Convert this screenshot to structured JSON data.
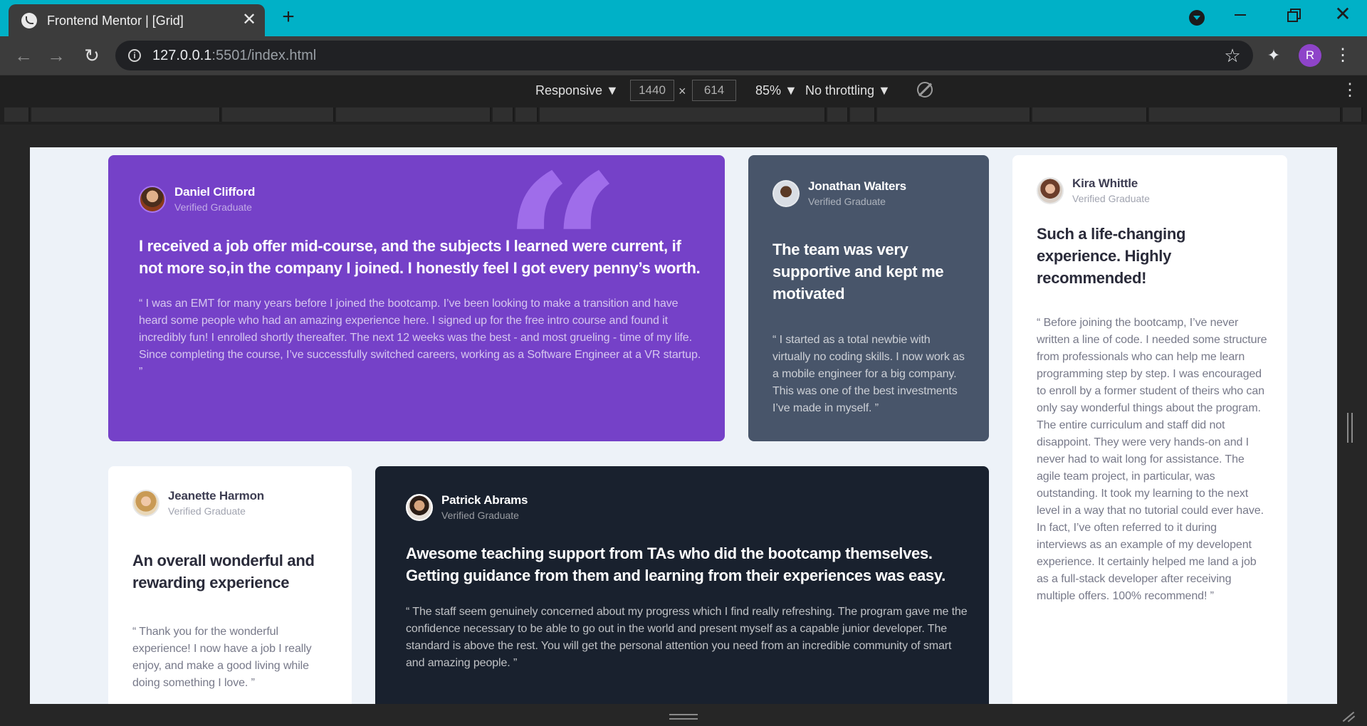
{
  "browser": {
    "tab_title": "Frontend Mentor | [Grid]",
    "url_host": "127.0.0.1",
    "url_rest": ":5501/index.html",
    "profile_initial": "R"
  },
  "devtools": {
    "device": "Responsive ▼",
    "width": "1440",
    "height": "614",
    "times": "×",
    "zoom": "85% ▼",
    "throttling": "No throttling ▼"
  },
  "cards": {
    "daniel": {
      "name": "Daniel Clifford",
      "role": "Verified Graduate",
      "headline": "I received a job offer mid-course, and the subjects I learned were current, if not more so,in the company I joined. I honestly feel I got every penny’s worth.",
      "body": "“ I was an EMT for many years before I joined the bootcamp. I’ve been looking to make a transition and have heard some people who had an amazing experience here. I signed up for the free intro course and found it incredibly fun! I enrolled shortly thereafter. The next 12 weeks was the best - and most grueling - time of my life. Since completing the course, I’ve successfully switched careers, working as a Software Engineer at a VR startup. ”",
      "quote_glyph": "“"
    },
    "jonathan": {
      "name": "Jonathan Walters",
      "role": "Verified Graduate",
      "headline": "The team was very supportive and kept me motivated",
      "body": "“ I started as a total newbie with virtually no coding skills. I now work as a mobile engineer for a big company. This was one of the best investments I’ve made in myself. ”"
    },
    "kira": {
      "name": "Kira Whittle",
      "role": "Verified Graduate",
      "headline": "Such a life-changing experience. Highly recommended!",
      "body": "“ Before joining the bootcamp, I’ve never written a line of code. I needed some structure from professionals who can help me learn programming step by step. I was encouraged to enroll by a former student of theirs who can only say wonderful things about the program. The entire curriculum and staff did not disappoint. They were very hands-on and I never had to wait long for assistance. The agile team project, in particular, was outstanding. It took my learning to the next level in a way that no tutorial could ever have. In fact, I’ve often referred to it during interviews as an example of my developent experience. It certainly helped me land a job as a full-stack developer after receiving multiple offers. 100% recommend! ”"
    },
    "jeanette": {
      "name": "Jeanette Harmon",
      "role": "Verified Graduate",
      "headline": "An overall wonderful and rewarding experience",
      "body": "“ Thank you for the wonderful experience! I now have a job I really enjoy, and make a good living while doing something I love. ”"
    },
    "patrick": {
      "name": "Patrick Abrams",
      "role": "Verified Graduate",
      "headline": "Awesome teaching support from TAs who did the bootcamp themselves. Getting guidance from them and learning from their experiences was easy.",
      "body": "“ The staff seem genuinely concerned about my progress which I find really refreshing. The program gave me the confidence necessary to be able to go out in the world and present myself as a capable junior developer. The standard is above the rest. You will get the personal attention you need from an incredible community of smart and amazing people. ”"
    }
  },
  "colors": {
    "purple": "#7541c8",
    "slate": "#48556a",
    "dark": "#19212e",
    "page_bg": "#edf2f8",
    "chrome_accent": "#00b1c7"
  }
}
